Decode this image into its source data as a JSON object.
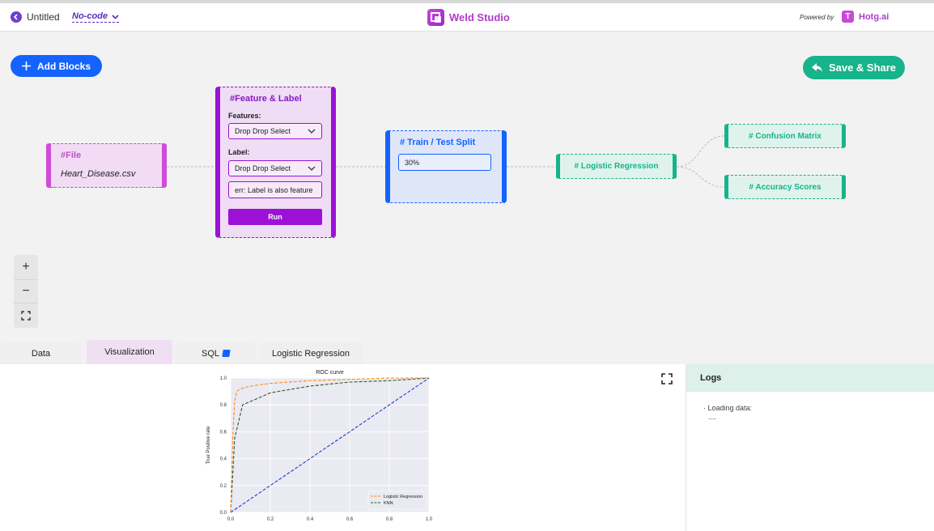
{
  "header": {
    "doc_title": "Untitled",
    "mode": "No-code",
    "brand": "Weld Studio",
    "powered_by": "Powered by",
    "partner": "Hotg.ai"
  },
  "toolbar": {
    "add_blocks": "Add Blocks",
    "save_share": "Save & Share"
  },
  "nodes": {
    "file": {
      "title": "#File",
      "filename": "Heart_Disease.csv"
    },
    "feature": {
      "title": "#Feature & Label",
      "features_label": "Features:",
      "features_value": "Drop Drop Select",
      "label_label": "Label:",
      "label_value": "Drop Drop Select",
      "error": "err: Label is also feature",
      "run": "Run"
    },
    "split": {
      "title": "# Train / Test Split",
      "value": "30%"
    },
    "logistic": {
      "title": "# Logistic Regression"
    },
    "confusion": {
      "title": "# Confusion Matrix"
    },
    "accuracy": {
      "title": "# Accuracy Scores"
    }
  },
  "zoom": {
    "in": "+",
    "out": "−"
  },
  "tabs": [
    {
      "label": "Data"
    },
    {
      "label": "Visualization"
    },
    {
      "label": "SQL"
    },
    {
      "label": "Logistic Regression"
    }
  ],
  "logs": {
    "title": "Logs",
    "line": "·  Loading data:",
    "dots": "...."
  },
  "colors": {
    "file": "#d14bd9",
    "feature": "#9b12d6",
    "split": "#1463ff",
    "model": "#17b38a"
  },
  "chart_data": {
    "type": "line",
    "title": "ROC curve",
    "xlabel": "",
    "ylabel": "True Positive rate",
    "xlim": [
      0,
      1
    ],
    "ylim": [
      0,
      1
    ],
    "x_ticks": [
      "0.0",
      "0.2",
      "0.4",
      "0.6",
      "0.8",
      "1.0"
    ],
    "y_ticks": [
      "0.0",
      "0.2",
      "0.4",
      "0.6",
      "0.8",
      "1.0"
    ],
    "grid": true,
    "legend": "bottom-right",
    "series": [
      {
        "name": "Logistic Regression",
        "color": "#ff8c1a",
        "points": [
          [
            0,
            0
          ],
          [
            0.01,
            0.55
          ],
          [
            0.02,
            0.82
          ],
          [
            0.03,
            0.9
          ],
          [
            0.05,
            0.92
          ],
          [
            0.1,
            0.94
          ],
          [
            0.2,
            0.96
          ],
          [
            0.4,
            0.98
          ],
          [
            0.6,
            0.99
          ],
          [
            0.8,
            1.0
          ],
          [
            1.0,
            1.0
          ]
        ]
      },
      {
        "name": "KNN",
        "color": "#2e5c2e",
        "points": [
          [
            0,
            0
          ],
          [
            0.02,
            0.55
          ],
          [
            0.06,
            0.8
          ],
          [
            0.2,
            0.89
          ],
          [
            0.4,
            0.94
          ],
          [
            0.6,
            0.97
          ],
          [
            0.8,
            0.98
          ],
          [
            1.0,
            1.0
          ]
        ]
      },
      {
        "name": "",
        "color": "#1a3be0",
        "points": [
          [
            0,
            0
          ],
          [
            1,
            1
          ]
        ]
      }
    ]
  }
}
